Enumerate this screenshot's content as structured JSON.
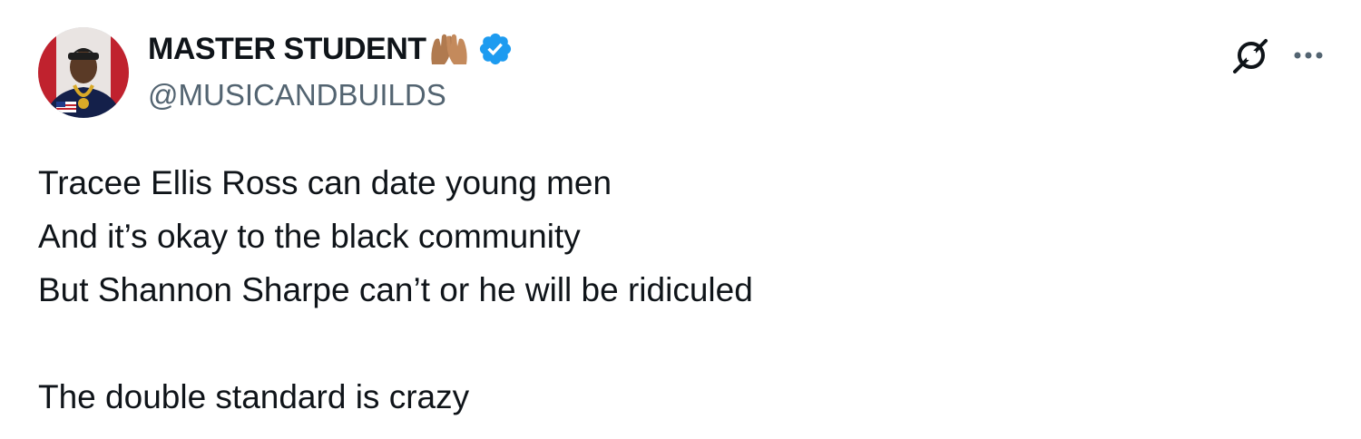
{
  "author": {
    "display_name": "MASTER STUDENT",
    "name_emoji": "raised-hands-emoji",
    "verified": true,
    "verified_color": "#1d9bf0",
    "handle": "@MUSICANDBUILDS"
  },
  "avatar": {
    "icon": "profile-photo"
  },
  "actions": {
    "grok_icon": "grok-icon",
    "more_icon": "more-options-icon"
  },
  "tweet": {
    "lines": [
      "Tracee Ellis Ross can date young men",
      "And it’s okay to the black community",
      "But Shannon Sharpe can’t or he will be ridiculed",
      "",
      "The double standard is crazy"
    ]
  },
  "colors": {
    "text_primary": "#0f1419",
    "text_secondary": "#536471",
    "background": "#ffffff"
  }
}
